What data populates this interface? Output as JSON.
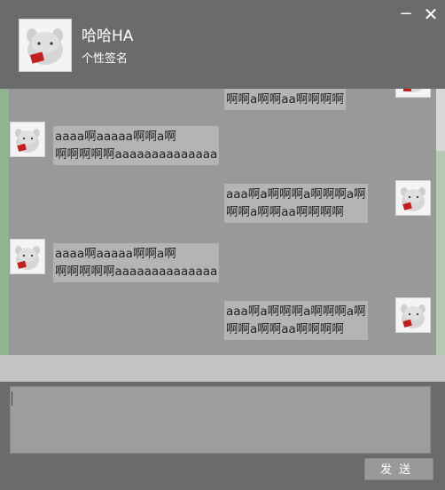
{
  "header": {
    "nickname": "哈哈HA",
    "signature": "个性签名",
    "minimize_icon": "minimize-icon",
    "close_icon": "close-icon",
    "minimize_glyph": "−",
    "close_glyph": "✕"
  },
  "messages": [
    {
      "side": "right",
      "lines": [
        "啊啊a啊啊aa啊啊啊啊"
      ]
    },
    {
      "side": "left",
      "lines": [
        "aaaa啊aaaaa啊啊a啊",
        "啊啊啊啊啊aaaaaaaaaaaaaa"
      ]
    },
    {
      "side": "right",
      "lines": [
        "aaa啊a啊啊啊a啊啊啊a啊",
        "啊啊a啊啊aa啊啊啊啊"
      ]
    },
    {
      "side": "left",
      "lines": [
        "aaaa啊aaaaa啊啊a啊",
        "啊啊啊啊啊aaaaaaaaaaaaaa"
      ]
    },
    {
      "side": "right",
      "lines": [
        "aaa啊a啊啊啊a啊啊啊a啊",
        "啊啊a啊啊aa啊啊啊啊"
      ]
    }
  ],
  "input": {
    "value": ""
  },
  "send_button": {
    "label": "发送"
  }
}
